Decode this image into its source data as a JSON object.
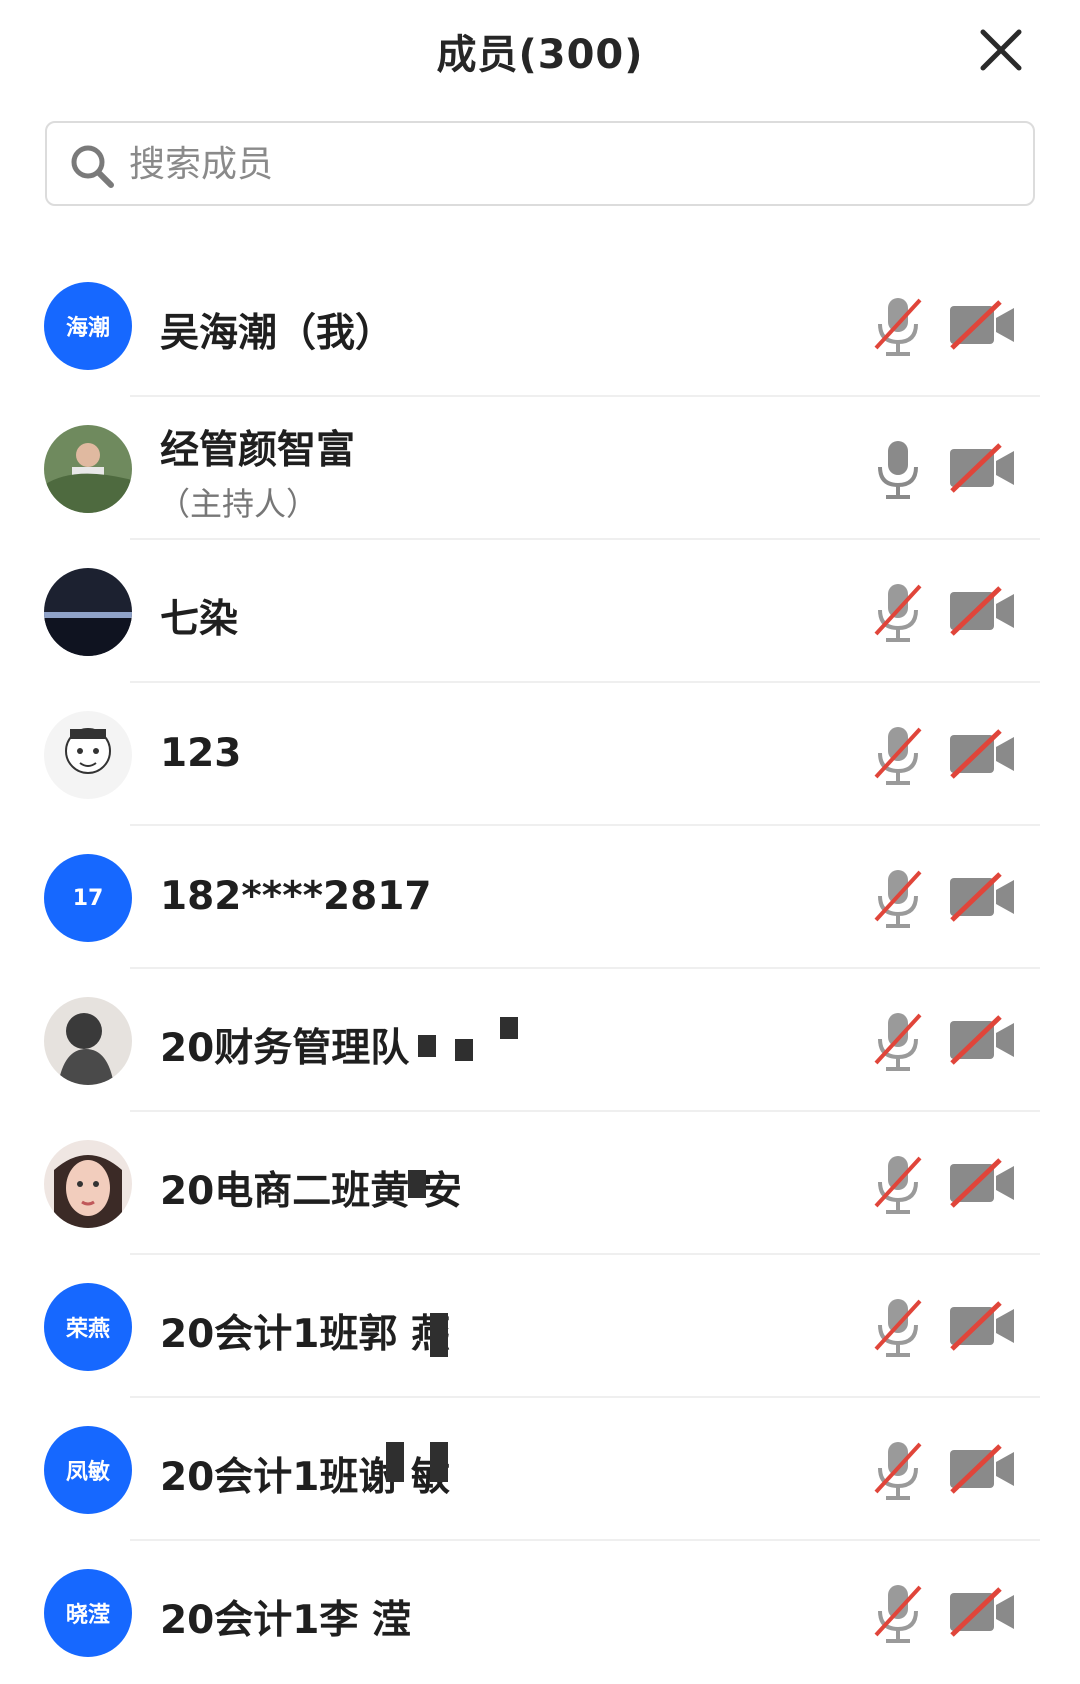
{
  "header": {
    "title": "成员(300)"
  },
  "search": {
    "placeholder": "搜索成员"
  },
  "members": [
    {
      "avatar_text": "海潮",
      "name": "吴海潮（我）",
      "mic": "muted",
      "camera": "off"
    },
    {
      "avatar_icon": "photo-avatar-icon",
      "name": "经管颜智富",
      "role": "（主持人）",
      "mic": "on",
      "camera": "off"
    },
    {
      "avatar_icon": "night-photo-avatar-icon",
      "name": "七染",
      "mic": "muted",
      "camera": "off"
    },
    {
      "avatar_icon": "cartoon-avatar-icon",
      "name": "123",
      "mic": "muted",
      "camera": "off"
    },
    {
      "avatar_text": "17",
      "name": "182****2817",
      "mic": "muted",
      "camera": "off"
    },
    {
      "avatar_icon": "portrait-avatar-icon",
      "name": "20财务管理队",
      "mic": "muted",
      "camera": "off"
    },
    {
      "avatar_icon": "girl-avatar-icon",
      "name": "20电商二班黄  安",
      "mic": "muted",
      "camera": "off"
    },
    {
      "avatar_text": "荣燕",
      "name": "20会计1班郭  燕",
      "mic": "muted",
      "camera": "off"
    },
    {
      "avatar_text": "凤敏",
      "name": "20会计1班谢  敏",
      "mic": "muted",
      "camera": "off"
    },
    {
      "avatar_text": "晓滢",
      "name": "20会计1李  滢",
      "mic": "muted",
      "camera": "off"
    }
  ],
  "colors": {
    "accent": "#1668ff",
    "muted_red": "#e0453a",
    "icon_gray": "#8a8a8a"
  }
}
